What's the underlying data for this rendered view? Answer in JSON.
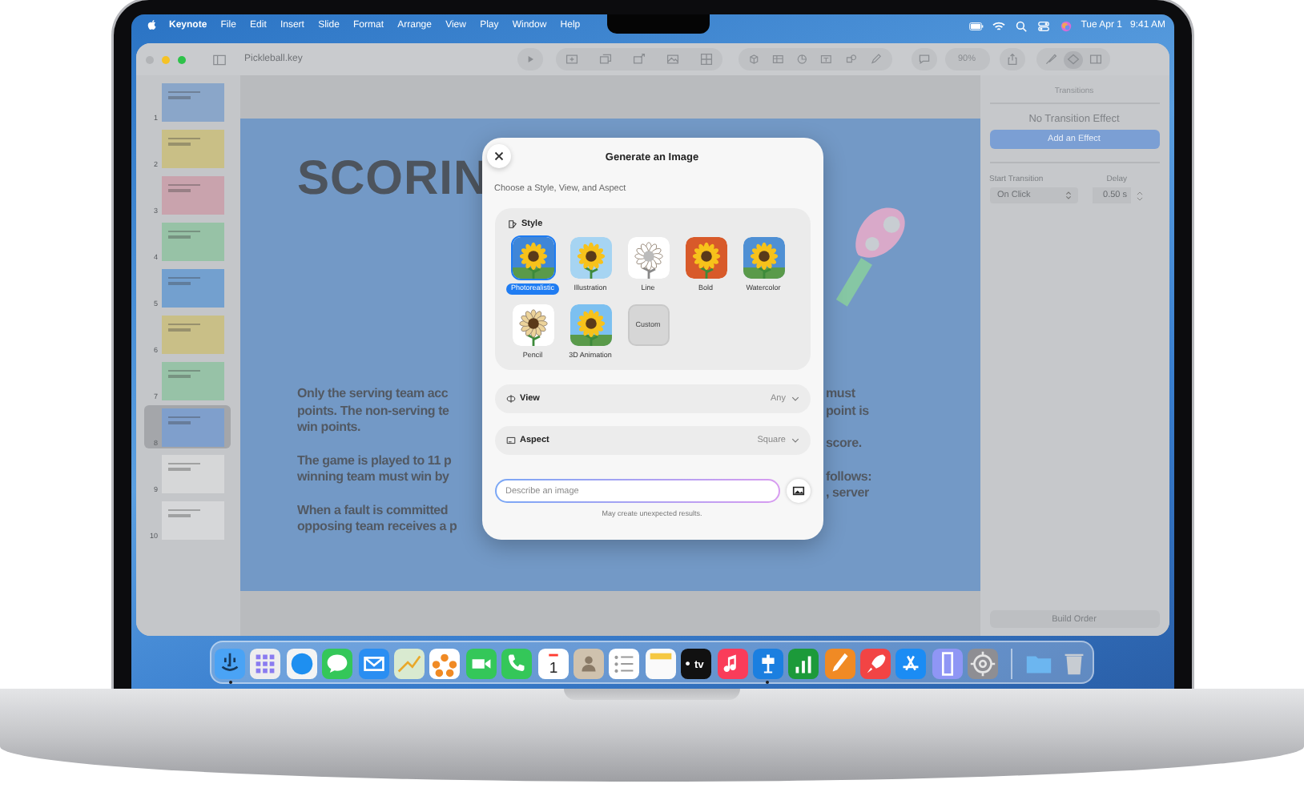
{
  "menu_bar": {
    "app": "Keynote",
    "items": [
      "File",
      "Edit",
      "Insert",
      "Slide",
      "Format",
      "Arrange",
      "View",
      "Play",
      "Window",
      "Help"
    ],
    "date": "Tue Apr 1",
    "time": "9:41 AM"
  },
  "window": {
    "title": "Pickleball.key",
    "zoom": "90%",
    "inspector_buttons": [
      {
        "kind": "brush",
        "selected": false
      },
      {
        "kind": "diamond",
        "selected": true
      },
      {
        "kind": "document",
        "selected": false
      }
    ]
  },
  "slides": [
    {
      "number": "1",
      "color": "#8aa6c9",
      "selected": false
    },
    {
      "number": "2",
      "color": "#c9bf86",
      "selected": false
    },
    {
      "number": "3",
      "color": "#c9a3ad",
      "selected": false
    },
    {
      "number": "4",
      "color": "#97c2a6",
      "selected": false
    },
    {
      "number": "5",
      "color": "#73a0cf",
      "selected": false
    },
    {
      "number": "6",
      "color": "#c9bf87",
      "selected": false
    },
    {
      "number": "7",
      "color": "#97c2a7",
      "selected": false
    },
    {
      "number": "8",
      "color": "#7f9fcc",
      "selected": true
    },
    {
      "number": "9",
      "color": "#d6d7d8",
      "selected": false
    },
    {
      "number": "10",
      "color": "#d6d7d9",
      "selected": false
    }
  ],
  "slide": {
    "title": "SCORIN",
    "left": [
      [
        "Only the serving team acc",
        "points. The non-serving te",
        "win points."
      ],
      [
        "The game is played to 11 p",
        "winning team must win by"
      ],
      [
        "When a fault is committed",
        "opposing team receives a p"
      ]
    ],
    "right": [
      [
        "must",
        "point is"
      ],
      [
        "score."
      ],
      [
        "follows:",
        ", server"
      ]
    ]
  },
  "panel": {
    "heading": "Transitions",
    "empty": "No Transition Effect",
    "add_button": "Add an Effect",
    "start_label": "Start Transition",
    "start_value": "On Click",
    "delay_label": "Delay",
    "delay_value": "0.50 s",
    "build_button": "Build Order"
  },
  "dialog": {
    "title": "Generate an Image",
    "subtitle": "Choose a Style, View, and Aspect",
    "style_heading": "Style",
    "styles": [
      {
        "label": "Photorealistic",
        "kind": "photo",
        "selected": true
      },
      {
        "label": "Illustration",
        "kind": "illustration",
        "selected": false
      },
      {
        "label": "Line",
        "kind": "line",
        "selected": false
      },
      {
        "label": "Bold",
        "kind": "bold",
        "selected": false
      },
      {
        "label": "Watercolor",
        "kind": "watercolor",
        "selected": false
      },
      {
        "label": "Pencil",
        "kind": "pencil",
        "selected": false
      },
      {
        "label": "3D Animation",
        "kind": "animation",
        "selected": false
      },
      {
        "label": "Custom",
        "kind": "custom",
        "selected": false
      }
    ],
    "options": [
      {
        "kind": "view",
        "label": "View",
        "value": "Any"
      },
      {
        "kind": "aspect",
        "label": "Aspect",
        "value": "Square"
      }
    ],
    "prompt": {
      "placeholder": "Describe an image"
    },
    "note": "May create unexpected results."
  },
  "dock": [
    {
      "kind": "finder",
      "running": true
    },
    {
      "kind": "launchpad",
      "running": false
    },
    {
      "kind": "safari",
      "running": false
    },
    {
      "kind": "messages",
      "running": false
    },
    {
      "kind": "mail",
      "running": false
    },
    {
      "kind": "maps",
      "running": false
    },
    {
      "kind": "photos",
      "running": false
    },
    {
      "kind": "facetime",
      "running": false
    },
    {
      "kind": "phone",
      "running": false
    },
    {
      "kind": "calendar",
      "label": "1",
      "running": false
    },
    {
      "kind": "contacts",
      "running": false
    },
    {
      "kind": "reminders",
      "running": false
    },
    {
      "kind": "notes",
      "running": false
    },
    {
      "kind": "tv",
      "label": "tv",
      "running": false
    },
    {
      "kind": "music",
      "running": false
    },
    {
      "kind": "keynote",
      "running": true
    },
    {
      "kind": "numbers",
      "running": false
    },
    {
      "kind": "pages",
      "running": false
    },
    {
      "kind": "rocket",
      "running": false
    },
    {
      "kind": "appstore",
      "running": false
    },
    {
      "kind": "mirroring",
      "running": false
    },
    {
      "kind": "settings",
      "running": false
    },
    {
      "kind": "folder",
      "running": false
    },
    {
      "kind": "trash",
      "running": false
    }
  ]
}
